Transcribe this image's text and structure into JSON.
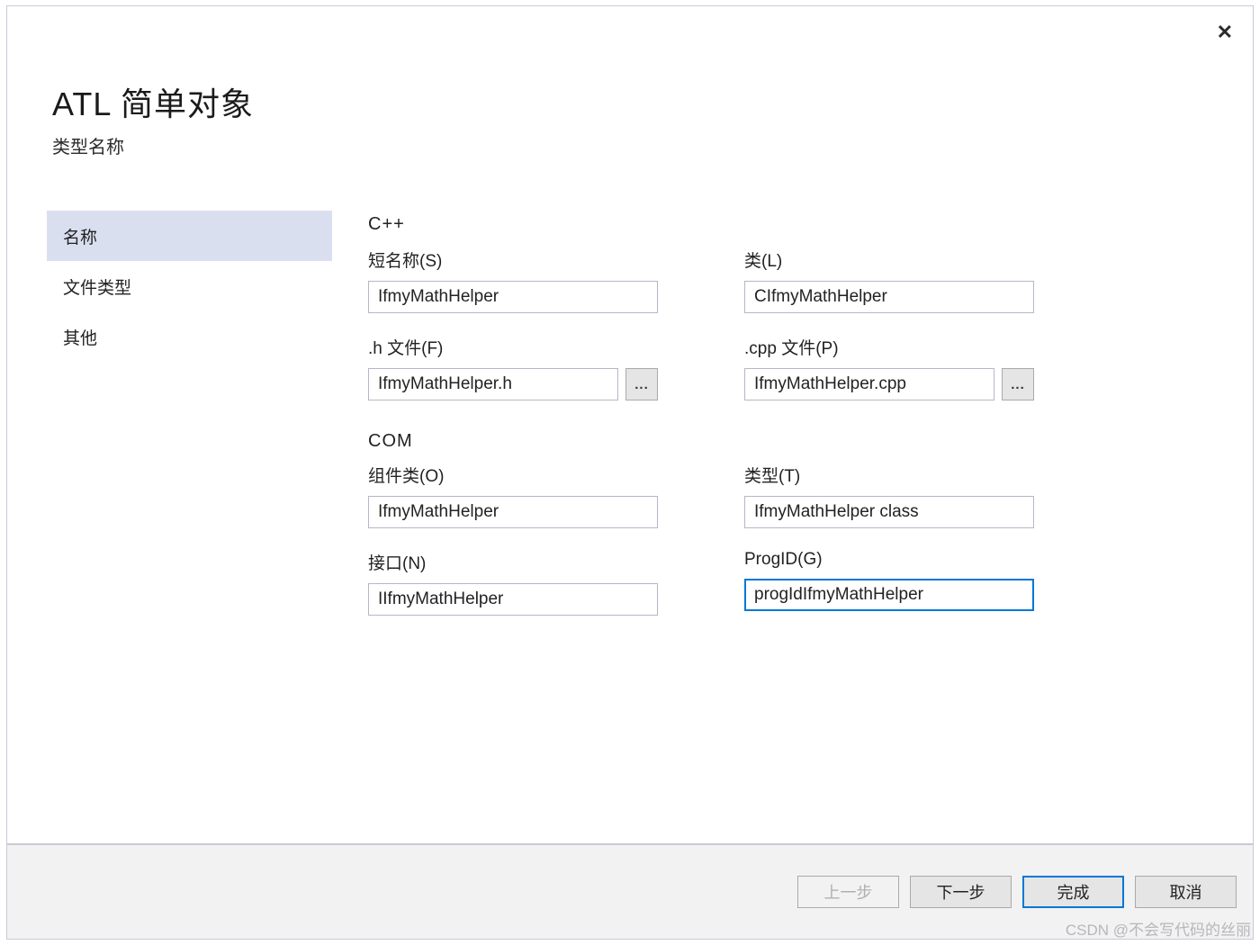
{
  "header": {
    "title": "ATL 简单对象",
    "subtitle": "类型名称"
  },
  "close_icon": "✕",
  "sidebar": {
    "items": [
      {
        "label": "名称",
        "selected": true
      },
      {
        "label": "文件类型",
        "selected": false
      },
      {
        "label": "其他",
        "selected": false
      }
    ]
  },
  "form": {
    "cpp": {
      "section": "C++",
      "short_name": {
        "label": "短名称(S)",
        "value": "IfmyMathHelper"
      },
      "class_field": {
        "label": "类(L)",
        "value": "CIfmyMathHelper"
      },
      "h_file": {
        "label": ".h 文件(F)",
        "value": "IfmyMathHelper.h",
        "browse": "..."
      },
      "cpp_file": {
        "label": ".cpp 文件(P)",
        "value": "IfmyMathHelper.cpp",
        "browse": "..."
      }
    },
    "com": {
      "section": "COM",
      "coclass": {
        "label": "组件类(O)",
        "value": "IfmyMathHelper"
      },
      "type_field": {
        "label": "类型(T)",
        "value": "IfmyMathHelper class"
      },
      "interface_field": {
        "label": "接口(N)",
        "value": "IIfmyMathHelper"
      },
      "progid": {
        "label": "ProgID(G)",
        "value": "progIdIfmyMathHelper"
      }
    }
  },
  "footer": {
    "prev": "上一步",
    "next": "下一步",
    "finish": "完成",
    "cancel": "取消"
  },
  "watermark": "CSDN @不会写代码的丝丽"
}
